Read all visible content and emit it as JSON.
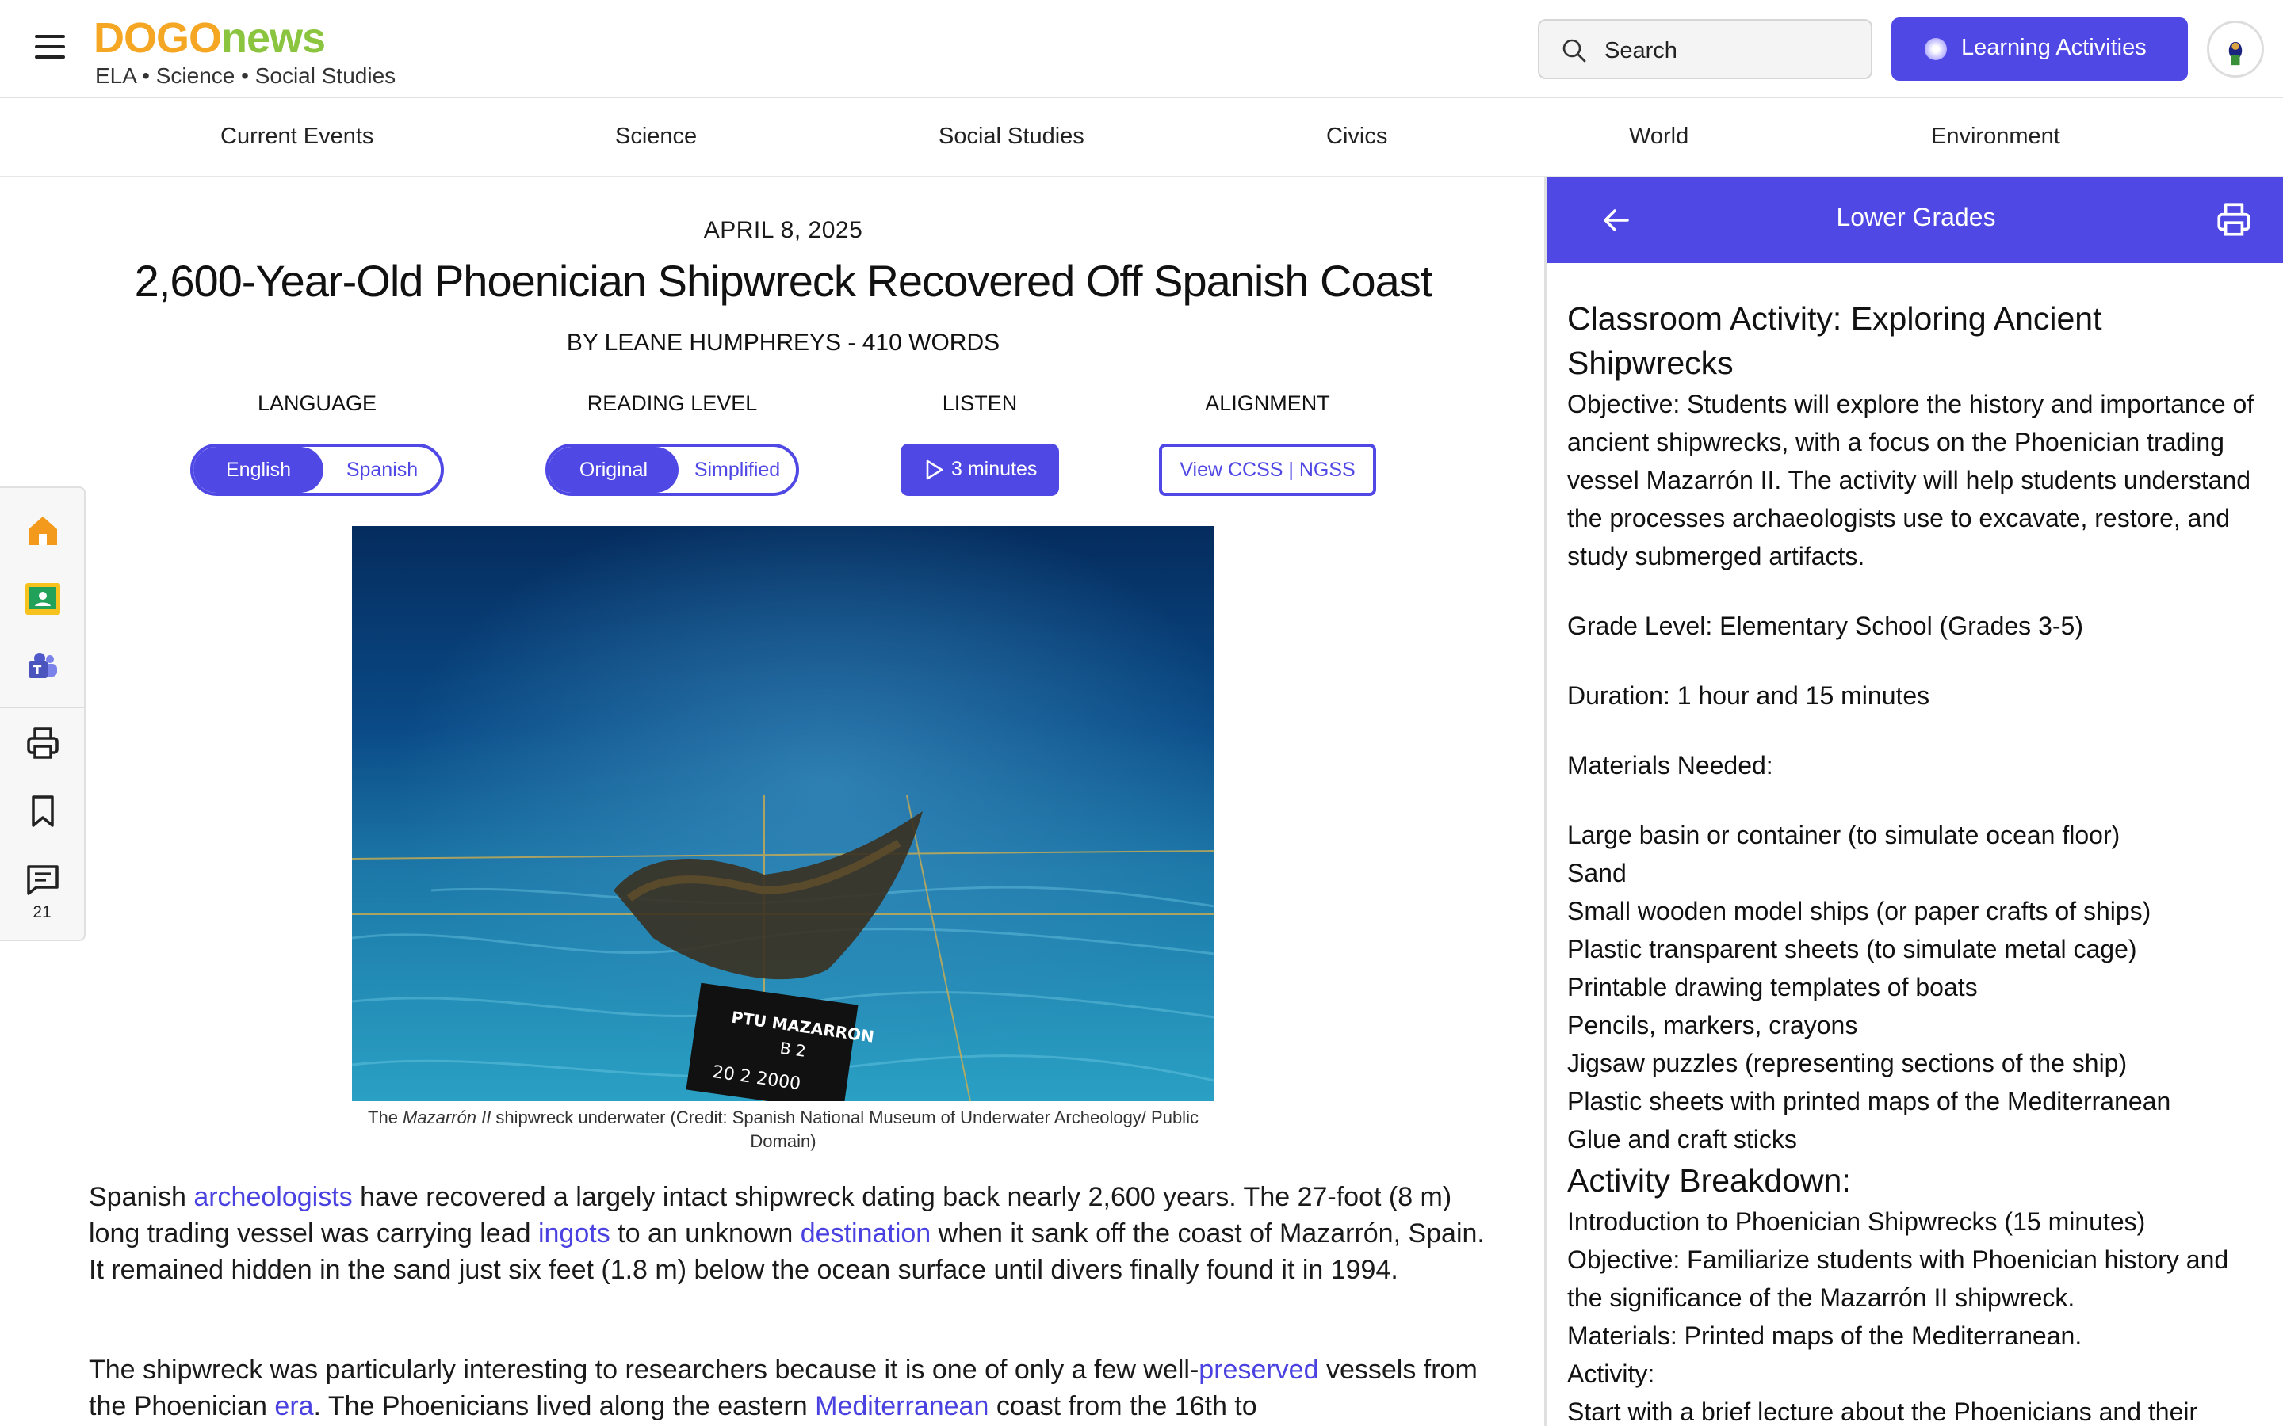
{
  "header": {
    "logo_dogo": "DOGO",
    "logo_news": "news",
    "tagline": "ELA • Science • Social Studies",
    "search_placeholder": "Search",
    "learning_label": "Learning Activities"
  },
  "nav": [
    "Current Events",
    "Science",
    "Social Studies",
    "Civics",
    "World",
    "Environment"
  ],
  "toolbar": {
    "comment_count": "21"
  },
  "article": {
    "date": "APRIL 8, 2025",
    "title": "2,600-Year-Old Phoenician Shipwreck Recovered Off Spanish Coast",
    "byline": "BY LEANE HUMPHREYS - 410 WORDS",
    "language_label": "LANGUAGE",
    "language_options": [
      "English",
      "Spanish"
    ],
    "reading_label": "READING LEVEL",
    "reading_options": [
      "Original",
      "Simplified"
    ],
    "listen_label": "LISTEN",
    "listen_button": "3 minutes",
    "alignment_label": "ALIGNMENT",
    "alignment_button": "View CCSS | NGSS",
    "photo_sign_lines": [
      "PTU MAZARRON",
      "B 2",
      "20 2 2000"
    ],
    "caption_pre": "The ",
    "caption_em": "Mazarrón II",
    "caption_post": " shipwreck underwater (Credit: Spanish National Museum of Underwater Archeology/ Public Domain)",
    "p1": [
      "Spanish ",
      "archeologists",
      " have recovered a largely intact shipwreck dating back nearly 2,600 years. The 27-foot (8 m) long trading vessel was carrying lead ",
      "ingots",
      " to an unknown ",
      "destination",
      " when it sank off the coast of Mazarrón, Spain. It remained hidden in the sand just six feet (1.8 m) below the ocean surface until divers finally found it in 1994."
    ],
    "p2": [
      "The shipwreck was particularly interesting to researchers because it is one of only a few well-",
      "preserved",
      " vessels from the Phoenician ",
      "era",
      ". The Phoenicians lived along the eastern ",
      "Mediterranean",
      " coast from the 16th to"
    ]
  },
  "panel": {
    "title": "Lower Grades",
    "heading": "Classroom Activity: Exploring Ancient Shipwrecks",
    "objective": "Objective: Students will explore the history and importance of ancient shipwrecks, with a focus on the Phoenician trading vessel Mazarrón II. The activity will help students understand the processes archaeologists use to excavate, restore, and study submerged artifacts.",
    "grade": "Grade Level: Elementary School (Grades 3-5)",
    "duration": "Duration: 1 hour and 15 minutes",
    "materials_label": "Materials Needed:",
    "materials": [
      "Large basin or container (to simulate ocean floor)",
      "Sand",
      "Small wooden model ships (or paper crafts of ships)",
      "Plastic transparent sheets (to simulate metal cage)",
      "Printable drawing templates of boats",
      "Pencils, markers, crayons",
      "Jigsaw puzzles (representing sections of the ship)",
      "Plastic sheets with printed maps of the Mediterranean",
      "Glue and craft sticks"
    ],
    "breakdown_heading": "Activity Breakdown:",
    "breakdown": [
      "Introduction to Phoenician Shipwrecks (15 minutes)",
      "Objective: Familiarize students with Phoenician history and the significance of the Mazarrón II shipwreck.",
      "Materials: Printed maps of the Mediterranean.",
      "Activity:",
      "Start with a brief lecture about the Phoenicians and their"
    ]
  },
  "colors": {
    "accent": "#5048e5",
    "logo_orange": "#f5a623",
    "logo_green": "#8bc53f",
    "link": "#4a42e0"
  }
}
